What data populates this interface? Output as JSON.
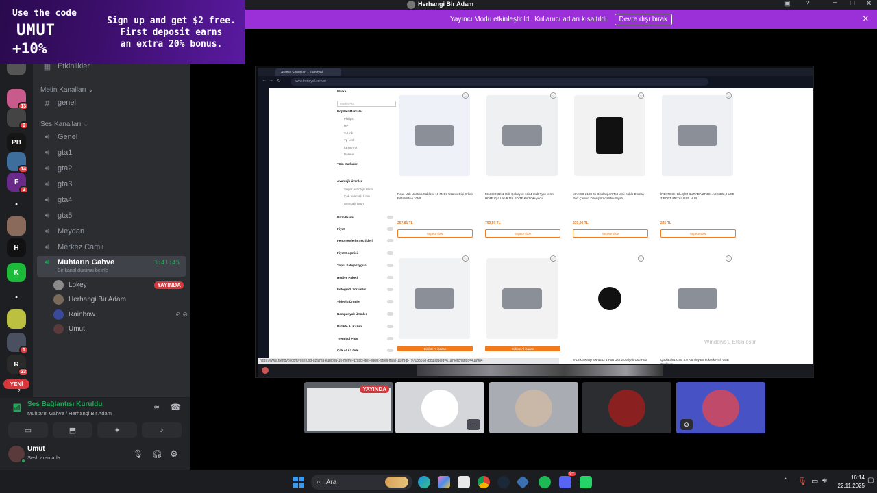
{
  "promo": {
    "line1": "Use the code",
    "line2": "UMUT",
    "line3": "+10%",
    "right1": "Sign up and get $2 free.",
    "right2": "First deposit earns",
    "right3": "an extra 20% bonus."
  },
  "servers": [
    {
      "abbr": "",
      "badge": "13",
      "color": "#c95a8c"
    },
    {
      "abbr": "",
      "badge": "9",
      "color": "#444"
    },
    {
      "abbr": "PB",
      "badge": "",
      "color": "#151515"
    },
    {
      "abbr": "",
      "badge": "14",
      "color": "#3d6e9c"
    },
    {
      "abbr": "F",
      "badge": "2",
      "color": "#6a2a8a"
    },
    {
      "abbr": "▪",
      "badge": "",
      "color": "#1e1f22"
    },
    {
      "abbr": "",
      "badge": "",
      "color": "#8a6a5a"
    },
    {
      "abbr": "H",
      "badge": "",
      "color": "#111"
    },
    {
      "abbr": "K",
      "badge": "",
      "color": "#1dbb3a"
    },
    {
      "abbr": "▪",
      "badge": "",
      "color": "#1e1f22"
    },
    {
      "abbr": "",
      "badge": "",
      "color": "#bcc040"
    },
    {
      "abbr": "",
      "badge": "1",
      "color": "#4a5060"
    },
    {
      "abbr": "R",
      "badge": "23",
      "color": "#2a2a2a"
    }
  ],
  "new_badge": "YENİ",
  "new_badge_count": "2",
  "channels": {
    "partial_top": "Etkinlikler",
    "text_category": "Metin Kanalları",
    "text_channels": [
      "genel"
    ],
    "voice_category": "Ses Kanalları",
    "voice_channels": [
      "Genel",
      "gta1",
      "gta2",
      "gta3",
      "gta4",
      "gta5",
      "Meydan",
      "Merkez Camii"
    ],
    "active": {
      "name": "Muhtarın Gahve",
      "timer": "3:41:45",
      "status": "Bir kanal durumu belirle"
    },
    "users": [
      {
        "name": "Lokey",
        "live": "YAYINDA"
      },
      {
        "name": "Herhangi Bir Adam",
        "live": ""
      },
      {
        "name": "Rainbow",
        "live": ""
      },
      {
        "name": "Umut",
        "live": ""
      }
    ]
  },
  "voice_panel": {
    "title": "Ses Bağlantısı Kuruldu",
    "sub": "Muhtarın Gahve / Herhangi Bir Adam"
  },
  "user": {
    "name": "Umut",
    "status": "Sesli aramada"
  },
  "stream": {
    "title": "Herhangi Bir Adam",
    "banner_text": "Yayıncı Modu etkinleştirildi. Kullanıcı adları kısaltıldı.",
    "banner_button": "Devre dışı bırak"
  },
  "browser": {
    "tab_title": "Arama Sonuçları - Trendyol",
    "url": "www.trendyol.com/sr",
    "status_url": "https://www.trendyol.com/rose/usb-uzatma-kablosu-10-metre-uzatici-disi-erkek-filtreli-mavi-10mt-p-797183568?boutiqueId=61&merchantId=419984",
    "watermark": "Windows'u Etkinleştir"
  },
  "filters": [
    "Marka",
    "Marka Ara",
    "Popüler Markalar",
    "Philips",
    "HP",
    "S-Link",
    "Tp-Link",
    "LENOVO",
    "Baseus",
    "Tüm Markalar",
    "Avantajlı Ürünler",
    "Süper Avantajlı Ürün",
    "Çok Avantajlı Ürün",
    "Avantajlı Ürün",
    "Ürün Puanı",
    "Fiyat",
    "Fenomenlerin Seçtikleri",
    "Fiyat Geçmişi",
    "Toplu Satışa Uygun",
    "Hediye Paketi",
    "Fotoğraflı Yorumlar",
    "Videolu Ürünler",
    "Kampanyalı Ürünler",
    "Birlikte Al Kazan",
    "Trendyol Plus",
    "Çok Al Az Öde"
  ],
  "products": [
    {
      "title": "Rose Usb Uzatma Kablosu 10 Metre Uzatıcı Dişi Erkek Filtreli Mavi 10Mt",
      "price": "257,81 TL",
      "btn": "Sepete Ekle",
      "bg": "#eef2f8"
    },
    {
      "title": "MAXGO 3211 Usb Çoklayıcı 13in1 Hub Type-c 4K HDMI Vga Lan RJ45 SD TF Kart Okuyucu",
      "price": "799,50 TL",
      "btn": "Sepete Ekle",
      "bg": "#eef0f2"
    },
    {
      "title": "MAXGO 2108 4k Displayport To Hdmi Kablo Display Port Çevirici Dönüştürücü Mini Siyah",
      "price": "239,90 TL",
      "btn": "Sepete Ekle",
      "bg": "#f2f2f2"
    },
    {
      "title": "İNEKTECH BİLİŞİM BURADA ZR381 ADS 303,0 USB 7 PORT METAL USB HUB",
      "price": "245 TL",
      "btn": "Sepete Ekle",
      "bg": "#eef0f4"
    },
    {
      "title": "",
      "price": "",
      "btn": "Birlikte Al Kazan",
      "bg": "#f1f2f4"
    },
    {
      "title": "",
      "price": "",
      "btn": "Birlikte Al Kazan",
      "bg": "#f2f2f2"
    },
    {
      "title": "S-Link Swapp Sw-u242 4 Port Usb 2.0 Siyah Usb Hub",
      "price": "",
      "btn": "",
      "bg": "#fff"
    },
    {
      "title": "Qoola 3in1 USB 3.0 Alüminyum Yüksek Hızlı USB Çoklayıcı",
      "price": "",
      "btn": "",
      "bg": "#fff"
    }
  ],
  "thumbs": [
    {
      "label": "YAYINDA",
      "color": "#5b5f66"
    },
    {
      "label": "",
      "color": "#d4d6d9"
    },
    {
      "label": "",
      "color": "#a9acb2"
    },
    {
      "label": "",
      "color": "#2b2d31"
    },
    {
      "label": "",
      "color": "#4752c4"
    }
  ],
  "taskbar": {
    "search": "Ara",
    "time": "16:14",
    "date": "22.11.2025",
    "discord_badge": "9+"
  }
}
